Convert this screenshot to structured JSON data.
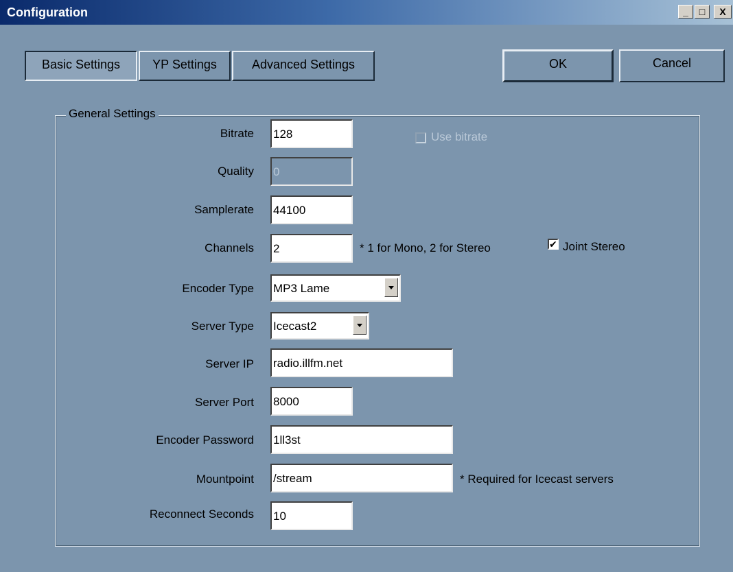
{
  "window": {
    "title": "Configuration",
    "minimize_glyph": "_",
    "maximize_glyph": "□",
    "close_glyph": "X"
  },
  "tabs": [
    {
      "label": "Basic Settings",
      "selected": true
    },
    {
      "label": "YP Settings",
      "selected": false
    },
    {
      "label": "Advanced Settings",
      "selected": false
    }
  ],
  "buttons": {
    "ok": "OK",
    "cancel": "Cancel"
  },
  "group": {
    "title": "General Settings"
  },
  "fields": {
    "bitrate": {
      "label": "Bitrate",
      "value": "128"
    },
    "quality": {
      "label": "Quality",
      "value": "0",
      "disabled": true
    },
    "samplerate": {
      "label": "Samplerate",
      "value": "44100"
    },
    "channels": {
      "label": "Channels",
      "value": "2"
    },
    "encoder_type": {
      "label": "Encoder Type",
      "value": "MP3 Lame"
    },
    "server_type": {
      "label": "Server Type",
      "value": "Icecast2"
    },
    "server_ip": {
      "label": "Server IP",
      "value": "radio.illfm.net"
    },
    "server_port": {
      "label": "Server Port",
      "value": "8000"
    },
    "encoder_password": {
      "label": "Encoder Password",
      "value": "1ll3st"
    },
    "mountpoint": {
      "label": "Mountpoint",
      "value": "/stream"
    },
    "reconnect_seconds": {
      "label": "Reconnect Seconds",
      "value": "10"
    }
  },
  "checkboxes": {
    "use_bitrate": {
      "label": "Use bitrate",
      "checked": false,
      "disabled": true
    },
    "joint_stereo": {
      "label": "Joint Stereo",
      "checked": true,
      "mark": "✔"
    }
  },
  "notes": {
    "channels_hint": "* 1 for Mono, 2 for Stereo",
    "mountpoint_hint": "* Required for Icecast servers"
  },
  "colors": {
    "background": "#7c95ad",
    "titlebar_start": "#0a2a6b",
    "titlebar_end": "#a7c1d6"
  }
}
